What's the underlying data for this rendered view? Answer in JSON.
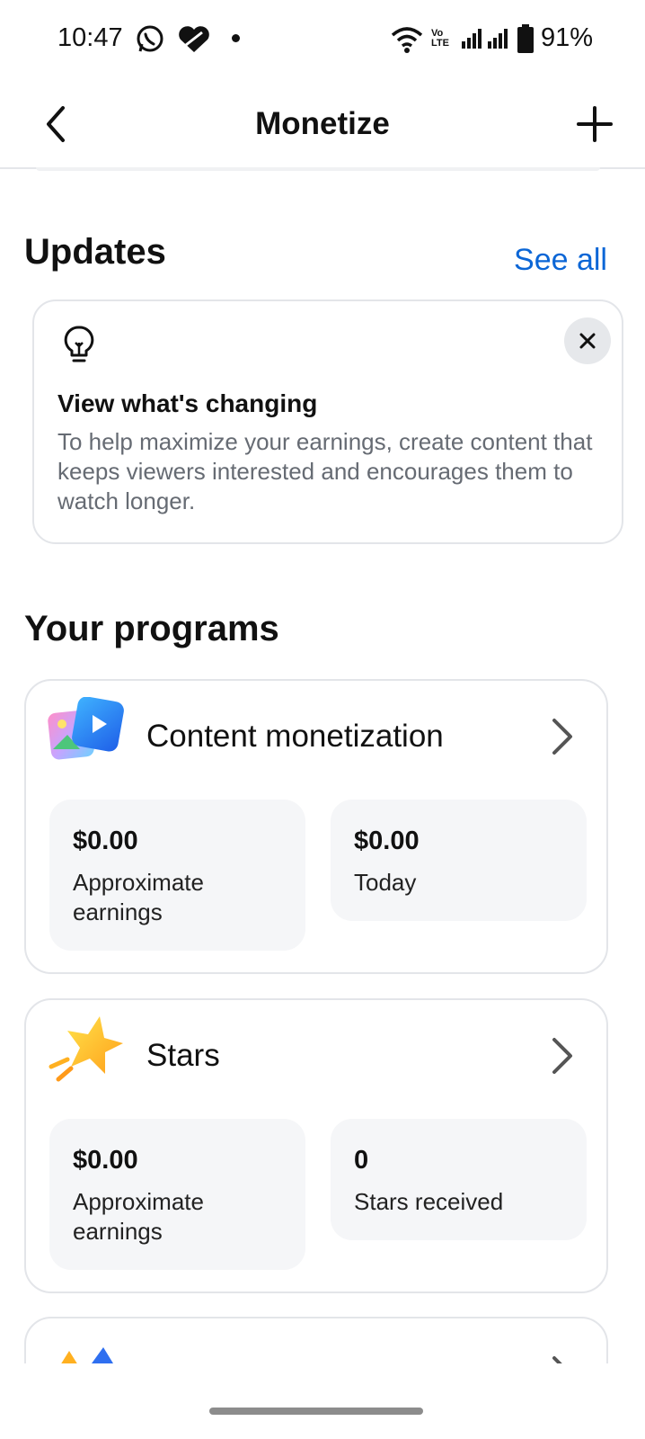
{
  "status_bar": {
    "time": "10:47",
    "carrier_label": "Vo LTE",
    "battery": "91%"
  },
  "header": {
    "title": "Monetize"
  },
  "updates": {
    "heading": "Updates",
    "see_all": "See all",
    "card": {
      "title": "View what's changing",
      "body": "To help maximize your earnings, create content that keeps viewers interested and encourages them to watch longer."
    }
  },
  "programs": {
    "heading": "Your programs",
    "items": [
      {
        "title": "Content monetization",
        "tiles": [
          {
            "value": "$0.00",
            "label": "Approximate earnings"
          },
          {
            "value": "$0.00",
            "label": "Today"
          }
        ]
      },
      {
        "title": "Stars",
        "tiles": [
          {
            "value": "$0.00",
            "label": "Approximate earnings"
          },
          {
            "value": "0",
            "label": "Stars received"
          }
        ]
      }
    ]
  },
  "colors": {
    "accent": "#0b66d6",
    "card_border": "#e3e5e9",
    "tile_bg": "#f5f6f8"
  }
}
